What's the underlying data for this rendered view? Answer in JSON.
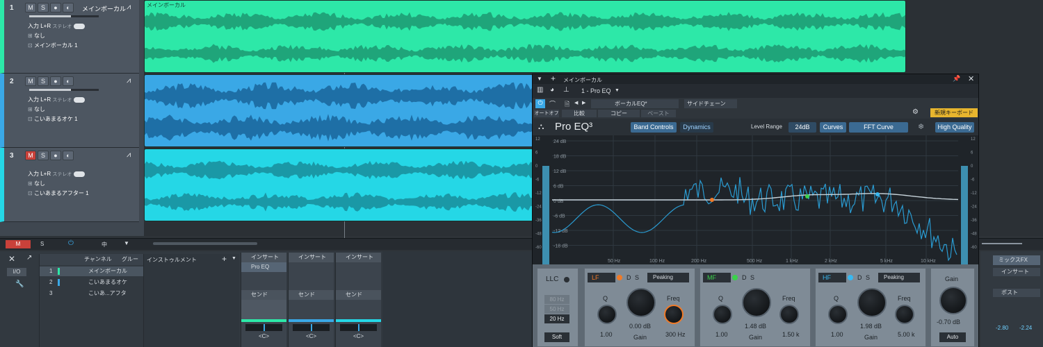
{
  "tracks": [
    {
      "num": "1",
      "name": "メインボーカル",
      "buttons": [
        "M",
        "S",
        "●",
        "◐"
      ],
      "input": "入力 L+R",
      "stereo": "ステレオ",
      "insert": "なし",
      "output": "メインボーカル 1",
      "clip": "メインボーカル",
      "color": "#2de8a8"
    },
    {
      "num": "2",
      "name": "",
      "buttons": [
        "M",
        "S",
        "●",
        "◐"
      ],
      "input": "入力 L+R",
      "stereo": "ステレオ",
      "insert": "なし",
      "output": "こいあまるオケ 1",
      "clip": "",
      "color": "#3aa8e6"
    },
    {
      "num": "3",
      "name": "",
      "buttons": [
        "M",
        "S",
        "●",
        "◐"
      ],
      "input": "入力 L+R",
      "stereo": "ステレオ",
      "insert": "なし",
      "output": "こいあまるアフター 1",
      "clip": "",
      "color": "#25d7e6"
    }
  ],
  "footer": {
    "m": "M",
    "s": "S",
    "mid": "中"
  },
  "mixer": {
    "channel_hdr": "チャンネル",
    "group_hdr": "グループ",
    "instrument_hdr": "インストゥルメント",
    "io": "I/O",
    "channels": [
      {
        "n": "1",
        "name": "メインボーカル",
        "color": "#2de8a8"
      },
      {
        "n": "2",
        "name": "こいあまるオケ",
        "color": "#3aa8e6"
      },
      {
        "n": "3",
        "name": "こいあ...アフタ",
        "color": "#25d7e6"
      }
    ],
    "insert_label": "インサート",
    "send_label": "センド",
    "plugin": "Pro EQ",
    "pan": "<C>"
  },
  "mixfx": {
    "title": "ミックスFX",
    "insert": "インサート",
    "post": "ポスト",
    "val1": "-2.80",
    "val2": "-2.24"
  },
  "eq": {
    "track": "メインボーカル",
    "plugin_slot": "1 - Pro EQ",
    "preset": "ボーカルEQ*",
    "sidechain": "サイドチェーン",
    "auto_off": "オートオフ",
    "compare": "比較",
    "copy": "コピー",
    "paste": "ペースト",
    "new_keyboard": "新規キーボード",
    "title": "Pro EQ³",
    "band_controls": "Band Controls",
    "dynamics": "Dynamics",
    "level_range_label": "Level Range",
    "level_range": "24dB",
    "curves": "Curves",
    "fft": "FFT Curve",
    "quality": "High Quality",
    "db_left": [
      "24 dB",
      "18 dB",
      "12 dB",
      "6 dB",
      "0 dB",
      "-6 dB",
      "-12 dB",
      "-18 dB"
    ],
    "db_outer_left": [
      "12",
      "6",
      "0",
      "-6",
      "-12",
      "-24",
      "-36",
      "-48",
      "-60"
    ],
    "db_right": [
      "12",
      "6",
      "0",
      "-6",
      "-12",
      "-24",
      "-36",
      "-48",
      "-60"
    ],
    "freq": [
      "50 Hz",
      "100 Hz",
      "200 Hz",
      "500 Hz",
      "1 kHz",
      "2 kHz",
      "5 kHz",
      "10 kHz"
    ],
    "llc": {
      "label": "LLC",
      "opts": [
        "80 Hz",
        "50 Hz",
        "20 Hz"
      ],
      "soft": "Soft"
    },
    "lf": {
      "label": "LF",
      "d": "D",
      "s": "S",
      "type": "Peaking",
      "q": "1.00",
      "gain": "0.00 dB",
      "freq": "300 Hz",
      "q_lbl": "Q",
      "gain_lbl": "Gain",
      "freq_lbl": "Freq",
      "color": "#f07a28"
    },
    "mf": {
      "label": "MF",
      "d": "D",
      "s": "S",
      "q": "1.00",
      "gain": "1.48 dB",
      "freq": "1.50 k",
      "q_lbl": "Q",
      "gain_lbl": "Gain",
      "freq_lbl": "Freq",
      "color": "#3ad24a"
    },
    "hf": {
      "label": "HF",
      "d": "D",
      "s": "S",
      "type": "Peaking",
      "q": "1.00",
      "gain": "1.98 dB",
      "freq": "5.00 k",
      "q_lbl": "Q",
      "gain_lbl": "Gain",
      "freq_lbl": "Freq",
      "color": "#38b8f0"
    },
    "out": {
      "label": "Gain",
      "value": "-0.70 dB",
      "auto": "Auto"
    }
  }
}
